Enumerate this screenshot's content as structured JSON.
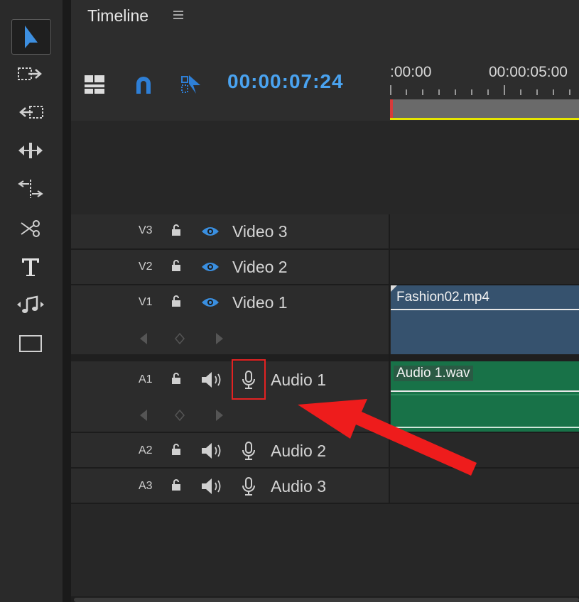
{
  "panel": {
    "title": "Timeline",
    "timecode": "00:00:07:24"
  },
  "ruler": {
    "labels": [
      ":00:00",
      "00:00:05:00"
    ]
  },
  "tools": [
    "selection-tool",
    "track-select-forward-tool",
    "track-select-backward-tool",
    "ripple-edit-tool",
    "rolling-edit-tool",
    "razor-tool",
    "type-tool",
    "audio-tool",
    "rectangle-tool"
  ],
  "tracks": {
    "video": [
      {
        "id": "V3",
        "label": "Video 3"
      },
      {
        "id": "V2",
        "label": "Video 2"
      },
      {
        "id": "V1",
        "label": "Video 1"
      }
    ],
    "audio": [
      {
        "id": "A1",
        "label": "Audio 1"
      },
      {
        "id": "A2",
        "label": "Audio 2"
      },
      {
        "id": "A3",
        "label": "Audio 3"
      }
    ]
  },
  "clips": {
    "video": "Fashion02.mp4",
    "audio": "Audio 1.wav"
  },
  "colors": {
    "accent": "#4aa3f0",
    "annotation": "#e32222",
    "video_clip": "#36526e",
    "audio_clip": "#187248"
  }
}
